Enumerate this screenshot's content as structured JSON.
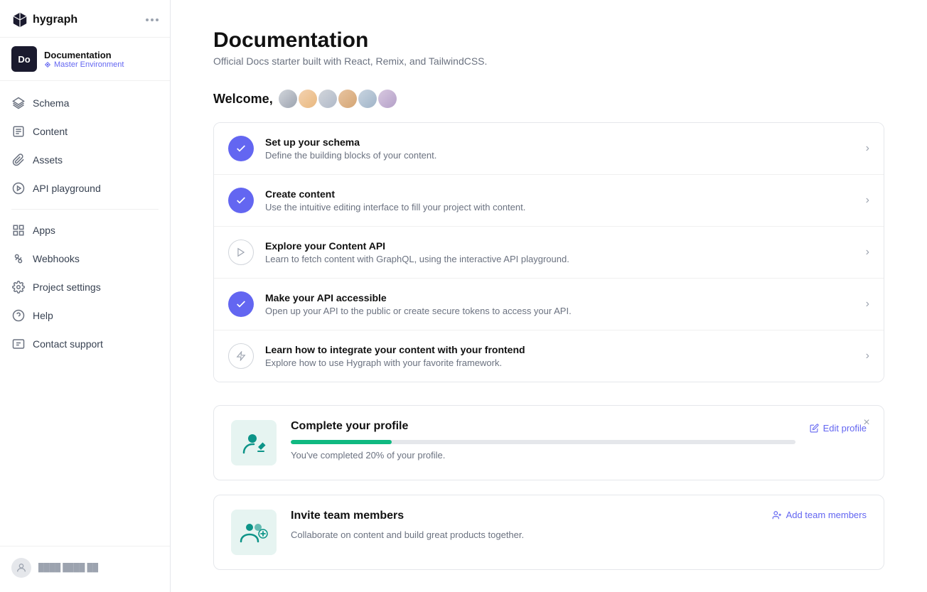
{
  "sidebar": {
    "logo": "hygraph",
    "project": {
      "initials": "Do",
      "name": "Documentation",
      "env": "Master Environment"
    },
    "nav_items": [
      {
        "id": "schema",
        "label": "Schema",
        "icon": "layers"
      },
      {
        "id": "content",
        "label": "Content",
        "icon": "edit"
      },
      {
        "id": "assets",
        "label": "Assets",
        "icon": "paperclip"
      },
      {
        "id": "api-playground",
        "label": "API playground",
        "icon": "play"
      }
    ],
    "bottom_items": [
      {
        "id": "apps",
        "label": "Apps",
        "icon": "grid"
      },
      {
        "id": "webhooks",
        "label": "Webhooks",
        "icon": "webhook"
      },
      {
        "id": "project-settings",
        "label": "Project settings",
        "icon": "settings"
      },
      {
        "id": "help",
        "label": "Help",
        "icon": "help-circle"
      },
      {
        "id": "contact-support",
        "label": "Contact support",
        "icon": "message"
      }
    ],
    "user": {
      "name": "User"
    }
  },
  "main": {
    "title": "Documentation",
    "subtitle": "Official Docs starter built with React, Remix, and TailwindCSS.",
    "welcome_prefix": "Welcome,",
    "steps": [
      {
        "id": "set-up-schema",
        "title": "Set up your schema",
        "desc": "Define the building blocks of your content.",
        "status": "completed",
        "icon": "check"
      },
      {
        "id": "create-content",
        "title": "Create content",
        "desc": "Use the intuitive editing interface to fill your project with content.",
        "status": "completed",
        "icon": "check"
      },
      {
        "id": "explore-api",
        "title": "Explore your Content API",
        "desc": "Learn to fetch content with GraphQL, using the interactive API playground.",
        "status": "pending",
        "icon": "play"
      },
      {
        "id": "api-accessible",
        "title": "Make your API accessible",
        "desc": "Open up your API to the public or create secure tokens to access your API.",
        "status": "completed",
        "icon": "check"
      },
      {
        "id": "integrate-frontend",
        "title": "Learn how to integrate your content with your frontend",
        "desc": "Explore how to use Hygraph with your favorite framework.",
        "status": "pending",
        "icon": "lightning"
      }
    ],
    "profile_card": {
      "title": "Complete your profile",
      "progress_percent": 20,
      "status_text": "You've completed 20% of your profile.",
      "edit_label": "Edit profile"
    },
    "team_card": {
      "title": "Invite team members",
      "desc": "Collaborate on content and build great products together.",
      "add_label": "Add team members"
    }
  }
}
